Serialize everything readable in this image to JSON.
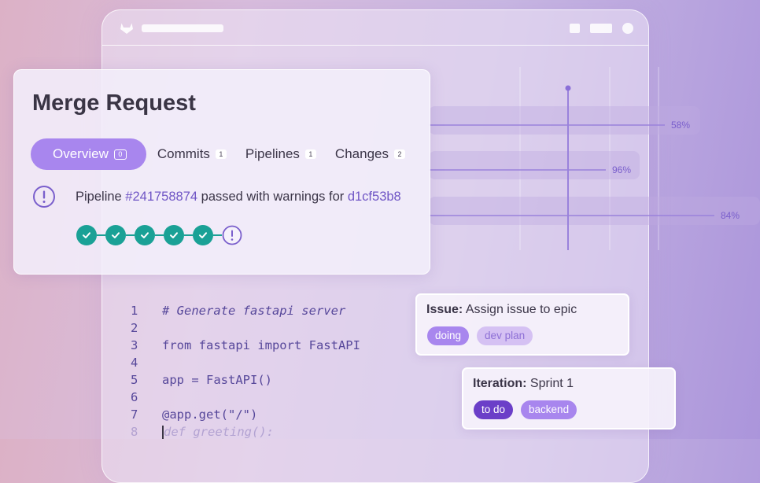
{
  "merge_request": {
    "title": "Merge Request",
    "tabs": [
      {
        "label": "Overview",
        "count": "0"
      },
      {
        "label": "Commits",
        "count": "1"
      },
      {
        "label": "Pipelines",
        "count": "1"
      },
      {
        "label": "Changes",
        "count": "2"
      }
    ],
    "pipeline": {
      "prefix": "Pipeline ",
      "id": "#241758874",
      "middle": " passed with warnings for ",
      "commit": "d1cf53b8"
    },
    "stage_icons": [
      "check-icon",
      "check-icon",
      "check-icon",
      "check-icon",
      "check-icon",
      "warning-icon"
    ]
  },
  "progress": [
    {
      "label": "58%",
      "value": 58
    },
    {
      "label": "96%",
      "value": 96
    },
    {
      "label": "84%",
      "value": 84
    }
  ],
  "code": {
    "lines": [
      {
        "num": "1",
        "text": "# Generate fastapi server"
      },
      {
        "num": "2",
        "text": ""
      },
      {
        "num": "3",
        "text": "from fastapi import FastAPI"
      },
      {
        "num": "4",
        "text": ""
      },
      {
        "num": "5",
        "text": "app = FastAPI()"
      },
      {
        "num": "6",
        "text": ""
      },
      {
        "num": "7",
        "text": "@app.get(\"/\")"
      },
      {
        "num": "8",
        "text": "def greeting():"
      }
    ]
  },
  "issue": {
    "label": "Issue:",
    "text": " Assign issue to epic",
    "chips": [
      "doing",
      "dev plan"
    ]
  },
  "iteration": {
    "label": "Iteration:",
    "text": " Sprint 1",
    "chips": [
      "to do",
      "backend"
    ]
  },
  "colors": {
    "accent": "#a886ee",
    "success": "#1aa196",
    "link": "#6f55c5"
  }
}
